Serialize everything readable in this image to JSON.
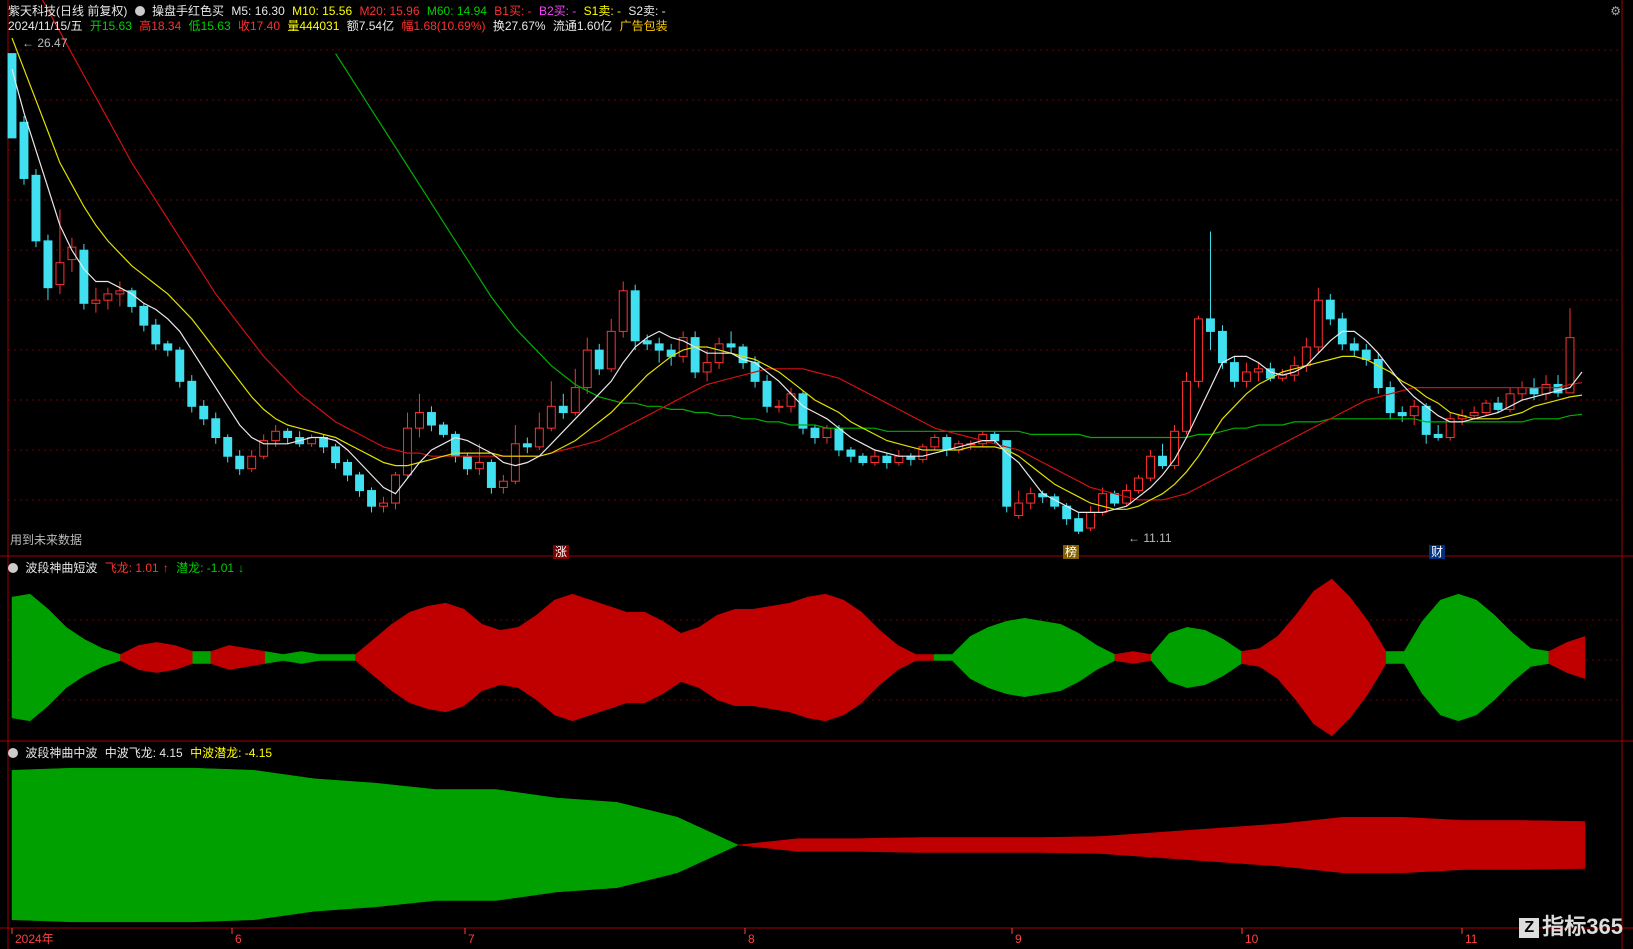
{
  "main_header": {
    "stock": "紫天科技(日线 前复权)",
    "indicator": "操盘手红色买",
    "ma5": "M5: 16.30",
    "ma10": "M10: 15.56",
    "ma20": "M20: 15.96",
    "ma60": "M60: 14.94",
    "b1": "B1买: -",
    "b2": "B2买: -",
    "s1": "S1卖: -",
    "s2": "S2卖: -"
  },
  "quote_line": {
    "date": "2024/11/15/五",
    "open": "开15.63",
    "high": "高18.34",
    "low": "低15.63",
    "close": "收17.40",
    "volume": "量444031",
    "amount": "额7.54亿",
    "change": "幅1.68(10.69%)",
    "turnover": "换27.67%",
    "float": "流通1.60亿",
    "ad": "广告包装"
  },
  "annotations": {
    "high_label": "26.47",
    "low_label": "11.11",
    "future_data": "用到未来数据",
    "tag_zhang": "涨",
    "tag_bang": "榜",
    "tag_cai": "财"
  },
  "panel2": {
    "title": "波段神曲短波",
    "up": "飞龙: 1.01",
    "down": "潜龙: -1.01"
  },
  "panel3": {
    "title": "波段神曲中波",
    "up": "中波飞龙: 4.15",
    "down": "中波潜龙: -4.15"
  },
  "xaxis": {
    "labels": [
      "2024年",
      "6",
      "7",
      "8",
      "9",
      "10",
      "11"
    ]
  },
  "logo": {
    "mark": "Z",
    "text": "指标365"
  },
  "colors": {
    "up_candle": "#ff3030",
    "down_candle": "#40e0f0",
    "ma5": "#e8e8e8",
    "ma10": "#e0e000",
    "ma20": "#d01010",
    "ma60": "#00b000",
    "wave_green": "#00a000",
    "wave_red": "#c00000"
  },
  "chart_data": {
    "type": "candlestick",
    "ylim": [
      10.5,
      27
    ],
    "candles": [
      [
        26.5,
        23.8,
        24.2,
        26.47
      ],
      [
        24.3,
        22.5,
        22.3,
        24.5
      ],
      [
        22.6,
        20.5,
        20.3,
        22.8
      ],
      [
        20.5,
        19.0,
        18.6,
        20.7
      ],
      [
        19.1,
        19.8,
        18.8,
        21.5
      ],
      [
        19.9,
        20.3,
        19.5,
        20.6
      ],
      [
        20.2,
        18.5,
        18.3,
        20.4
      ],
      [
        18.5,
        18.6,
        18.2,
        19.0
      ],
      [
        18.6,
        18.8,
        18.3,
        19.0
      ],
      [
        18.8,
        18.9,
        18.4,
        19.2
      ],
      [
        18.9,
        18.4,
        18.2,
        19.0
      ],
      [
        18.4,
        17.8,
        17.6,
        18.5
      ],
      [
        17.8,
        17.2,
        17.0,
        18.0
      ],
      [
        17.2,
        17.0,
        16.8,
        17.3
      ],
      [
        17.0,
        16.0,
        15.8,
        17.1
      ],
      [
        16.0,
        15.2,
        15.0,
        16.2
      ],
      [
        15.2,
        14.8,
        14.6,
        15.4
      ],
      [
        14.8,
        14.2,
        14.0,
        15.0
      ],
      [
        14.2,
        13.6,
        13.4,
        14.3
      ],
      [
        13.6,
        13.2,
        13.0,
        13.8
      ],
      [
        13.2,
        13.6,
        13.1,
        13.8
      ],
      [
        13.6,
        14.1,
        13.5,
        14.3
      ],
      [
        14.1,
        14.4,
        13.9,
        14.6
      ],
      [
        14.4,
        14.2,
        14.0,
        14.5
      ],
      [
        14.2,
        14.0,
        13.9,
        14.4
      ],
      [
        14.0,
        14.2,
        13.9,
        14.3
      ],
      [
        14.2,
        13.9,
        13.7,
        14.3
      ],
      [
        13.9,
        13.4,
        13.2,
        14.0
      ],
      [
        13.4,
        13.0,
        12.8,
        13.5
      ],
      [
        13.0,
        12.5,
        12.3,
        13.1
      ],
      [
        12.5,
        12.0,
        11.8,
        12.6
      ],
      [
        12.0,
        12.1,
        11.8,
        12.3
      ],
      [
        12.1,
        13.0,
        11.9,
        13.1
      ],
      [
        13.0,
        14.5,
        12.9,
        15.0
      ],
      [
        14.5,
        15.0,
        14.2,
        15.6
      ],
      [
        15.0,
        14.6,
        14.4,
        15.2
      ],
      [
        14.6,
        14.3,
        14.2,
        14.7
      ],
      [
        14.3,
        13.6,
        13.4,
        14.4
      ],
      [
        13.6,
        13.2,
        13.0,
        13.7
      ],
      [
        13.2,
        13.4,
        13.0,
        14.0
      ],
      [
        13.4,
        12.6,
        12.4,
        13.5
      ],
      [
        12.6,
        12.8,
        12.4,
        13.0
      ],
      [
        12.8,
        14.0,
        12.7,
        14.6
      ],
      [
        14.0,
        13.9,
        13.7,
        14.2
      ],
      [
        13.9,
        14.5,
        13.8,
        15.0
      ],
      [
        14.5,
        15.2,
        14.4,
        16.0
      ],
      [
        15.2,
        15.0,
        14.8,
        15.6
      ],
      [
        15.0,
        15.8,
        14.9,
        16.4
      ],
      [
        15.8,
        17.0,
        15.6,
        17.4
      ],
      [
        17.0,
        16.4,
        16.2,
        17.2
      ],
      [
        16.4,
        17.6,
        16.3,
        18.0
      ],
      [
        17.6,
        18.9,
        17.4,
        19.2
      ],
      [
        18.9,
        17.3,
        17.0,
        19.1
      ],
      [
        17.3,
        17.2,
        17.0,
        17.5
      ],
      [
        17.2,
        17.0,
        16.6,
        17.4
      ],
      [
        17.0,
        16.8,
        16.5,
        17.2
      ],
      [
        16.8,
        17.4,
        16.6,
        17.6
      ],
      [
        17.4,
        16.3,
        16.1,
        17.6
      ],
      [
        16.3,
        16.6,
        16.0,
        17.0
      ],
      [
        16.6,
        17.2,
        16.4,
        17.4
      ],
      [
        17.2,
        17.1,
        16.9,
        17.6
      ],
      [
        17.1,
        16.6,
        16.4,
        17.2
      ],
      [
        16.6,
        16.0,
        15.8,
        16.8
      ],
      [
        16.0,
        15.2,
        15.0,
        16.2
      ],
      [
        15.2,
        15.2,
        15.0,
        15.4
      ],
      [
        15.2,
        15.6,
        15.0,
        15.8
      ],
      [
        15.6,
        14.5,
        14.3,
        15.7
      ],
      [
        14.5,
        14.2,
        14.0,
        14.6
      ],
      [
        14.2,
        14.5,
        14.0,
        14.6
      ],
      [
        14.5,
        13.8,
        13.6,
        14.6
      ],
      [
        13.8,
        13.6,
        13.4,
        13.9
      ],
      [
        13.6,
        13.4,
        13.3,
        13.7
      ],
      [
        13.4,
        13.6,
        13.3,
        13.8
      ],
      [
        13.6,
        13.4,
        13.2,
        13.7
      ],
      [
        13.4,
        13.6,
        13.3,
        13.8
      ],
      [
        13.6,
        13.5,
        13.3,
        13.7
      ],
      [
        13.5,
        13.9,
        13.4,
        14.0
      ],
      [
        13.9,
        14.2,
        13.8,
        14.3
      ],
      [
        14.2,
        13.8,
        13.6,
        14.3
      ],
      [
        13.8,
        14.0,
        13.7,
        14.1
      ],
      [
        14.0,
        14.0,
        13.8,
        14.1
      ],
      [
        14.0,
        14.3,
        13.9,
        14.4
      ],
      [
        14.3,
        14.1,
        14.0,
        14.4
      ],
      [
        14.1,
        12.0,
        11.8,
        12.4
      ],
      [
        11.7,
        12.1,
        11.6,
        12.5
      ],
      [
        12.1,
        12.4,
        11.9,
        12.6
      ],
      [
        12.4,
        12.3,
        12.1,
        12.5
      ],
      [
        12.3,
        12.0,
        11.9,
        12.4
      ],
      [
        12.0,
        11.6,
        11.4,
        12.1
      ],
      [
        11.6,
        11.2,
        11.11,
        11.8
      ],
      [
        11.3,
        11.8,
        11.2,
        12.0
      ],
      [
        11.8,
        12.4,
        11.7,
        12.6
      ],
      [
        12.4,
        12.1,
        12.0,
        12.5
      ],
      [
        12.1,
        12.5,
        12.0,
        12.7
      ],
      [
        12.5,
        12.9,
        12.4,
        13.0
      ],
      [
        12.9,
        13.6,
        12.8,
        13.8
      ],
      [
        13.6,
        13.3,
        13.2,
        14.0
      ],
      [
        13.3,
        14.4,
        13.2,
        14.6
      ],
      [
        14.4,
        16.0,
        14.3,
        16.3
      ],
      [
        16.0,
        18.0,
        15.8,
        18.1
      ],
      [
        18.0,
        17.6,
        17.0,
        20.8
      ],
      [
        17.6,
        16.6,
        16.4,
        17.8
      ],
      [
        16.6,
        16.0,
        15.8,
        16.8
      ],
      [
        16.0,
        16.3,
        15.8,
        16.6
      ],
      [
        16.3,
        16.4,
        16.0,
        16.6
      ],
      [
        16.4,
        16.1,
        16.0,
        16.6
      ],
      [
        16.1,
        16.2,
        16.0,
        16.4
      ],
      [
        16.2,
        16.5,
        16.0,
        16.8
      ],
      [
        16.5,
        17.1,
        16.3,
        17.4
      ],
      [
        17.1,
        18.6,
        16.9,
        19.0
      ],
      [
        18.6,
        18.0,
        17.8,
        18.8
      ],
      [
        18.0,
        17.2,
        17.0,
        18.2
      ],
      [
        17.2,
        17.0,
        16.8,
        17.4
      ],
      [
        17.0,
        16.7,
        16.5,
        17.2
      ],
      [
        16.7,
        15.8,
        15.6,
        16.9
      ],
      [
        15.8,
        15.0,
        14.8,
        16.0
      ],
      [
        15.0,
        14.9,
        14.7,
        15.2
      ],
      [
        14.9,
        15.2,
        14.6,
        15.4
      ],
      [
        15.2,
        14.3,
        14.0,
        15.3
      ],
      [
        14.3,
        14.2,
        14.1,
        14.6
      ],
      [
        14.2,
        14.8,
        14.1,
        15.0
      ],
      [
        14.8,
        14.9,
        14.6,
        15.1
      ],
      [
        14.9,
        15.0,
        14.8,
        15.2
      ],
      [
        15.0,
        15.3,
        14.9,
        15.4
      ],
      [
        15.3,
        15.1,
        15.0,
        15.5
      ],
      [
        15.1,
        15.6,
        15.0,
        15.8
      ],
      [
        15.6,
        15.8,
        15.4,
        16.0
      ],
      [
        15.8,
        15.6,
        15.4,
        16.1
      ],
      [
        15.6,
        15.9,
        15.4,
        16.2
      ],
      [
        15.9,
        15.63,
        15.5,
        16.2
      ],
      [
        15.63,
        17.4,
        15.63,
        18.34
      ]
    ],
    "ma5": [
      26,
      24.6,
      23.4,
      22.2,
      21.0,
      20.2,
      19.6,
      19.2,
      19.2,
      19.0,
      18.8,
      18.5,
      18.3,
      18.0,
      17.6,
      17.0,
      16.4,
      15.8,
      15.2,
      14.6,
      14.2,
      14.0,
      14.0,
      14.0,
      14.1,
      14.2,
      14.2,
      14.1,
      13.8,
      13.4,
      13.0,
      12.6,
      12.4,
      12.9,
      13.4,
      13.8,
      14.0,
      14.2,
      14.1,
      13.9,
      13.7,
      13.4,
      13.3,
      13.4,
      13.6,
      14.0,
      14.4,
      14.8,
      15.2,
      15.6,
      16.0,
      16.6,
      17.1,
      17.4,
      17.6,
      17.4,
      17.3,
      17.1,
      16.9,
      16.9,
      16.9,
      16.7,
      16.6,
      16.3,
      16.0,
      15.6,
      15.2,
      15.0,
      14.8,
      14.5,
      14.2,
      14.0,
      13.8,
      13.7,
      13.6,
      13.6,
      13.6,
      13.7,
      13.8,
      13.9,
      14.0,
      14.1,
      14.1,
      13.7,
      13.4,
      12.9,
      12.4,
      12.2,
      12.0,
      11.8,
      11.8,
      11.8,
      11.9,
      12.0,
      12.3,
      12.6,
      13.0,
      13.5,
      14.2,
      15.0,
      15.8,
      16.6,
      16.8,
      16.8,
      16.6,
      16.3,
      16.2,
      16.3,
      16.5,
      16.9,
      17.3,
      17.6,
      17.6,
      17.3,
      16.9,
      16.4,
      15.9,
      15.5,
      15.2,
      14.9,
      14.7,
      14.7,
      14.8,
      14.9,
      15.0,
      15.2,
      15.4,
      15.5,
      15.6,
      15.7,
      15.8,
      16.3
    ],
    "ma10": [
      27,
      26,
      25,
      24,
      23,
      22.3,
      21.6,
      21.0,
      20.5,
      20.1,
      19.7,
      19.4,
      19.1,
      18.8,
      18.4,
      18.0,
      17.5,
      17.0,
      16.5,
      16.0,
      15.5,
      15.1,
      14.8,
      14.6,
      14.5,
      14.4,
      14.3,
      14.2,
      14.0,
      13.8,
      13.6,
      13.4,
      13.3,
      13.3,
      13.4,
      13.5,
      13.6,
      13.7,
      13.7,
      13.7,
      13.7,
      13.6,
      13.6,
      13.6,
      13.6,
      13.7,
      13.9,
      14.1,
      14.4,
      14.7,
      15.0,
      15.4,
      15.8,
      16.2,
      16.5,
      16.8,
      17.0,
      17.1,
      17.1,
      17.0,
      16.9,
      16.8,
      16.7,
      16.5,
      16.3,
      16.0,
      15.7,
      15.4,
      15.2,
      15.0,
      14.7,
      14.5,
      14.3,
      14.1,
      14.0,
      13.9,
      13.8,
      13.8,
      13.8,
      13.8,
      13.9,
      13.9,
      13.9,
      13.8,
      13.6,
      13.3,
      13.0,
      12.7,
      12.5,
      12.3,
      12.1,
      12.0,
      11.9,
      11.9,
      12.0,
      12.2,
      12.4,
      12.7,
      13.1,
      13.6,
      14.2,
      14.8,
      15.2,
      15.6,
      15.9,
      16.1,
      16.3,
      16.4,
      16.5,
      16.6,
      16.7,
      16.8,
      16.8,
      16.7,
      16.5,
      16.3,
      16.0,
      15.8,
      15.5,
      15.3,
      15.0,
      14.9,
      14.8,
      14.8,
      14.8,
      14.9,
      15.0,
      15.2,
      15.3,
      15.4,
      15.5,
      15.56
    ],
    "ma20": [
      30,
      29.3,
      28.6,
      27.9,
      27.2,
      26.5,
      25.8,
      25.1,
      24.4,
      23.7,
      23.0,
      22.4,
      21.8,
      21.2,
      20.6,
      20.0,
      19.4,
      18.8,
      18.3,
      17.8,
      17.3,
      16.8,
      16.4,
      16.0,
      15.6,
      15.3,
      15.0,
      14.7,
      14.5,
      14.3,
      14.1,
      13.9,
      13.8,
      13.7,
      13.7,
      13.6,
      13.6,
      13.6,
      13.6,
      13.6,
      13.6,
      13.6,
      13.6,
      13.6,
      13.6,
      13.7,
      13.8,
      13.9,
      14.0,
      14.1,
      14.3,
      14.5,
      14.7,
      14.9,
      15.1,
      15.3,
      15.5,
      15.7,
      15.9,
      16.0,
      16.1,
      16.2,
      16.3,
      16.4,
      16.4,
      16.4,
      16.4,
      16.3,
      16.2,
      16.1,
      15.9,
      15.7,
      15.5,
      15.3,
      15.1,
      14.9,
      14.7,
      14.5,
      14.4,
      14.3,
      14.2,
      14.1,
      14.0,
      13.9,
      13.8,
      13.6,
      13.4,
      13.2,
      13.0,
      12.8,
      12.6,
      12.5,
      12.4,
      12.3,
      12.2,
      12.2,
      12.2,
      12.3,
      12.4,
      12.6,
      12.8,
      13.0,
      13.2,
      13.4,
      13.6,
      13.8,
      14.0,
      14.2,
      14.4,
      14.6,
      14.8,
      15.0,
      15.2,
      15.4,
      15.5,
      15.6,
      15.7,
      15.8,
      15.8,
      15.8,
      15.8,
      15.8,
      15.8,
      15.8,
      15.8,
      15.8,
      15.8,
      15.8,
      15.8,
      15.8,
      15.9,
      15.96
    ],
    "ma60": [
      null,
      null,
      null,
      null,
      null,
      null,
      null,
      null,
      null,
      null,
      null,
      null,
      null,
      null,
      null,
      null,
      null,
      null,
      null,
      null,
      null,
      null,
      null,
      null,
      null,
      null,
      null,
      26.5,
      25.9,
      25.3,
      24.7,
      24.1,
      23.5,
      22.9,
      22.3,
      21.7,
      21.1,
      20.5,
      19.9,
      19.3,
      18.7,
      18.2,
      17.7,
      17.3,
      16.9,
      16.5,
      16.2,
      15.9,
      15.7,
      15.5,
      15.4,
      15.3,
      15.3,
      15.2,
      15.2,
      15.1,
      15.1,
      15.0,
      15.0,
      14.9,
      14.9,
      14.8,
      14.8,
      14.7,
      14.7,
      14.6,
      14.6,
      14.6,
      14.5,
      14.5,
      14.5,
      14.5,
      14.5,
      14.4,
      14.4,
      14.4,
      14.4,
      14.4,
      14.4,
      14.4,
      14.4,
      14.4,
      14.4,
      14.4,
      14.4,
      14.3,
      14.3,
      14.3,
      14.3,
      14.3,
      14.2,
      14.2,
      14.2,
      14.2,
      14.2,
      14.2,
      14.2,
      14.2,
      14.2,
      14.3,
      14.3,
      14.4,
      14.5,
      14.5,
      14.6,
      14.6,
      14.6,
      14.7,
      14.7,
      14.7,
      14.8,
      14.8,
      14.8,
      14.8,
      14.8,
      14.8,
      14.8,
      14.8,
      14.7,
      14.7,
      14.7,
      14.7,
      14.7,
      14.7,
      14.7,
      14.7,
      14.7,
      14.8,
      14.8,
      14.8,
      14.9,
      14.94
    ],
    "short_wave": [
      1.0,
      1.05,
      0.8,
      0.5,
      0.3,
      0.15,
      0.05,
      -0.2,
      -0.25,
      -0.2,
      0.1,
      -0.1,
      -0.2,
      -0.15,
      0.1,
      0.05,
      0.1,
      0.05,
      -0.05,
      0.05,
      -0.3,
      -0.55,
      -0.75,
      -0.85,
      -0.9,
      -0.8,
      -0.55,
      -0.45,
      -0.5,
      -0.7,
      -0.95,
      -1.05,
      -0.95,
      -0.85,
      -0.75,
      -0.75,
      -0.6,
      -0.4,
      -0.5,
      -0.7,
      -0.8,
      -0.8,
      -0.85,
      -0.9,
      -1.0,
      -1.05,
      -0.95,
      -0.75,
      -0.45,
      -0.2,
      -0.05,
      -0.05,
      0.05,
      0.35,
      0.5,
      0.6,
      0.65,
      0.6,
      0.55,
      0.4,
      0.2,
      -0.05,
      -0.1,
      0.05,
      0.4,
      0.5,
      0.45,
      0.3,
      0.1,
      -0.15,
      -0.35,
      -0.7,
      -1.1,
      -1.3,
      -1.0,
      -0.6,
      -0.1,
      0.1,
      0.6,
      0.95,
      1.05,
      0.95,
      0.7,
      0.4,
      0.15,
      -0.1,
      -0.25,
      -0.35
    ],
    "mid_wave": [
      3.5,
      3.6,
      3.6,
      3.6,
      3.5,
      3.1,
      2.9,
      2.6,
      2.6,
      2.2,
      2.0,
      1.3,
      0.0,
      -0.3,
      -0.3,
      -0.35,
      -0.35,
      -0.35,
      -0.4,
      -0.6,
      -0.8,
      -1.0,
      -1.3,
      -1.3,
      -1.15,
      -1.15,
      -1.1
    ]
  }
}
